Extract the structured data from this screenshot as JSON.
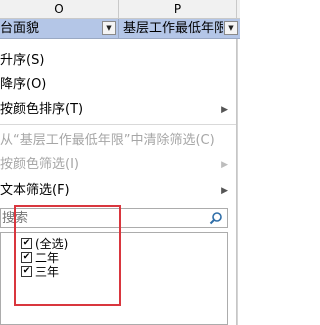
{
  "columns": {
    "o": "O",
    "p": "P"
  },
  "header_cells": {
    "o": "台面貌",
    "p": "基层工作最低年限"
  },
  "menu": {
    "items": [
      {
        "label": "升序(S)",
        "disabled": false,
        "submenu": false
      },
      {
        "label": "降序(O)",
        "disabled": false,
        "submenu": false
      },
      {
        "label": "按颜色排序(T)",
        "disabled": false,
        "submenu": true
      },
      {
        "label": "从“基层工作最低年限”中清除筛选(C)",
        "disabled": true,
        "submenu": false
      },
      {
        "label": "按颜色筛选(I)",
        "disabled": true,
        "submenu": true
      },
      {
        "label": "文本筛选(F)",
        "disabled": false,
        "submenu": true
      }
    ]
  },
  "search": {
    "placeholder": "搜索",
    "value": ""
  },
  "filter_list": [
    {
      "label": "(全选)",
      "checked": true
    },
    {
      "label": "二年",
      "checked": true
    },
    {
      "label": "三年",
      "checked": true
    }
  ],
  "colors": {
    "header_fill": "#b4c6e7",
    "highlight": "#d9363e",
    "search_icon": "#2f6ea8"
  }
}
